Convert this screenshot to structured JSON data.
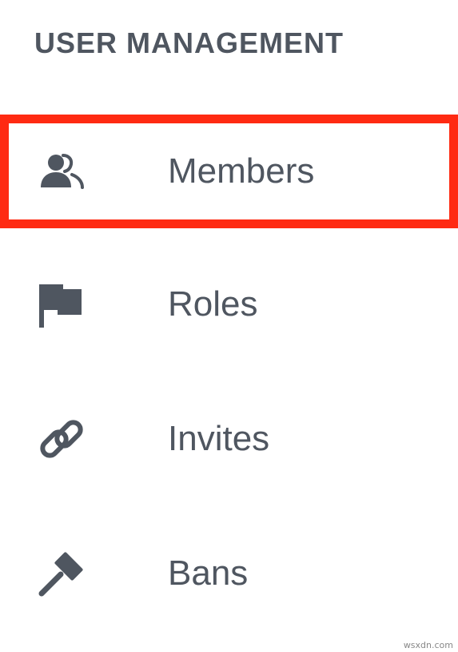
{
  "section": {
    "title": "USER MANAGEMENT"
  },
  "menu": {
    "items": [
      {
        "label": "Members",
        "icon": "members-icon",
        "highlighted": true
      },
      {
        "label": "Roles",
        "icon": "flag-icon",
        "highlighted": false
      },
      {
        "label": "Invites",
        "icon": "link-icon",
        "highlighted": false
      },
      {
        "label": "Bans",
        "icon": "hammer-icon",
        "highlighted": false
      }
    ]
  },
  "watermark": "wsxdn.com",
  "colors": {
    "text": "#4f5660",
    "highlight_border": "#ff2a12"
  }
}
